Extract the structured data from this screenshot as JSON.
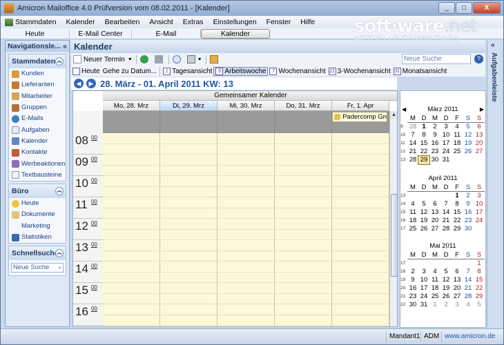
{
  "window": {
    "title": "Amicron Mailoffice 4.0 Prüfversion vom 08.02.2011 - [Kalender]",
    "buttons": [
      "_",
      "□",
      "X"
    ]
  },
  "menu": [
    "Stammdaten",
    "Kalender",
    "Bearbeiten",
    "Ansicht",
    "Extras",
    "Einstellungen",
    "Fenster",
    "Hilfe"
  ],
  "tabs": [
    "Heute",
    "E-Mail Center",
    "E-Mail",
    "Kalender"
  ],
  "watermark": {
    "logo_main": "soft·ware",
    "logo_tld": ".net",
    "sub": "AKTUELLE DOWNLOADS"
  },
  "nav": {
    "title": "Navigationsle...",
    "stammdaten": {
      "label": "Stammdaten",
      "items": [
        "Kunden",
        "Lieferanten",
        "Mitarbeiter",
        "Gruppen",
        "E-Mails",
        "Aufgaben",
        "Kalender",
        "Kontakte",
        "Werbeaktionen",
        "Textbausteine"
      ]
    },
    "buero": {
      "label": "Büro",
      "items": [
        "Heute",
        "Dokumente",
        "Marketing",
        "Statistiken"
      ]
    },
    "schnellsuche": {
      "label": "Schnellsuche",
      "placeholder": "Neue Suche"
    }
  },
  "main": {
    "title": "Kalender",
    "toolbar": {
      "new_term": "Neuer Termin",
      "search_placeholder": "Neue Suche"
    },
    "views": {
      "today": "Heute",
      "goto": "Gehe zu Datum...",
      "day": "Tagesansicht",
      "workweek": "Arbeitswoche",
      "week": "Wochenansicht",
      "threeweek": "3-Wochenansicht",
      "month": "Monatsansicht"
    },
    "date_range": "28. März - 01. April 2011  KW: 13",
    "calendar_group": "Gemeinsamer Kalender",
    "days": [
      "Mo, 28. Mrz",
      "Di, 29. Mrz",
      "Mi, 30. Mrz",
      "Do, 31. Mrz",
      "Fr, 1. Apr"
    ],
    "hours": [
      "08",
      "09",
      "10",
      "11",
      "12",
      "13",
      "14",
      "15",
      "16"
    ],
    "minutes": "00",
    "appointment": "Padercomp Gn"
  },
  "mini": {
    "dow": [
      "M",
      "D",
      "M",
      "D",
      "F",
      "S",
      "S"
    ],
    "months": [
      {
        "name": "März 2011",
        "weeks": [
          "9",
          "10",
          "11",
          "12",
          "13"
        ],
        "rows": [
          [
            "28",
            "1",
            "2",
            "3",
            "4",
            "5",
            "6"
          ],
          [
            "7",
            "8",
            "9",
            "10",
            "11",
            "12",
            "13"
          ],
          [
            "14",
            "15",
            "16",
            "17",
            "18",
            "19",
            "20"
          ],
          [
            "21",
            "22",
            "23",
            "24",
            "25",
            "26",
            "27"
          ],
          [
            "28",
            "29",
            "30",
            "31",
            "",
            "",
            ""
          ]
        ]
      },
      {
        "name": "April 2011",
        "weeks": [
          "13",
          "14",
          "15",
          "16",
          "17"
        ],
        "rows": [
          [
            "",
            "",
            "",
            "",
            "1",
            "2",
            "3"
          ],
          [
            "4",
            "5",
            "6",
            "7",
            "8",
            "9",
            "10"
          ],
          [
            "11",
            "12",
            "13",
            "14",
            "15",
            "16",
            "17"
          ],
          [
            "18",
            "19",
            "20",
            "21",
            "22",
            "23",
            "24"
          ],
          [
            "25",
            "26",
            "27",
            "28",
            "29",
            "30",
            ""
          ]
        ]
      },
      {
        "name": "Mai 2011",
        "weeks": [
          "17",
          "18",
          "19",
          "20",
          "21",
          "22"
        ],
        "rows": [
          [
            "",
            "",
            "",
            "",
            "",
            "",
            "1"
          ],
          [
            "2",
            "3",
            "4",
            "5",
            "6",
            "7",
            "8"
          ],
          [
            "9",
            "10",
            "11",
            "12",
            "13",
            "14",
            "15"
          ],
          [
            "16",
            "17",
            "18",
            "19",
            "20",
            "21",
            "22"
          ],
          [
            "23",
            "24",
            "25",
            "26",
            "27",
            "28",
            "29"
          ],
          [
            "30",
            "31",
            "1",
            "2",
            "3",
            "4",
            "5"
          ]
        ]
      }
    ]
  },
  "right_bar": {
    "label": "Aufgabenleiste"
  },
  "status": {
    "user": "Mandant1",
    "role": "ADM",
    "url": "www.amicron.de"
  },
  "colors": {
    "accent": "#1d54a8",
    "workarea": "#fdf9d8",
    "allday": "#9a9a9a"
  }
}
